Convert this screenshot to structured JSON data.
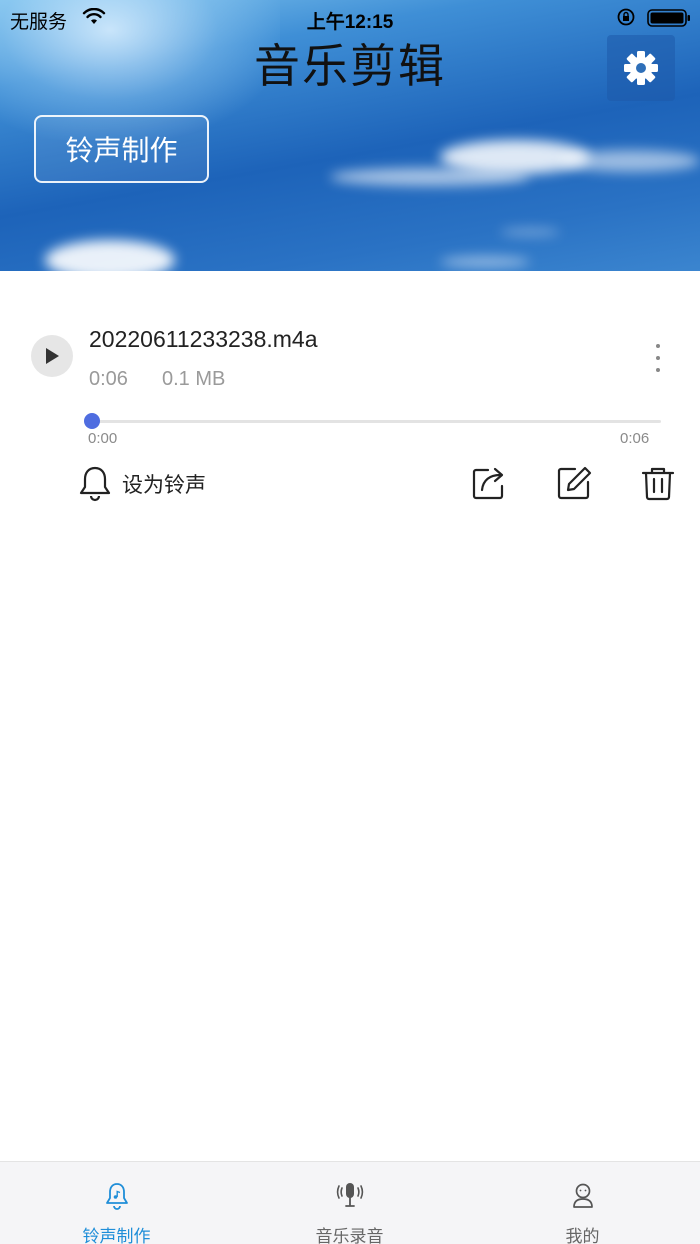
{
  "status_bar": {
    "carrier": "无服务",
    "time": "上午12:15"
  },
  "header": {
    "title": "音乐剪辑",
    "settings_icon": "gear-icon",
    "primary_button": "铃声制作"
  },
  "recording": {
    "file_name": "20220611233238.m4a",
    "duration": "0:06",
    "size": "0.1 MB",
    "progress": 0,
    "time_start": "0:00",
    "time_end": "0:06",
    "set_ringtone_label": "设为铃声",
    "actions": [
      "share-icon",
      "edit-icon",
      "delete-icon"
    ]
  },
  "tabs": [
    {
      "label": "铃声制作",
      "icon": "bell-music-icon",
      "active": true
    },
    {
      "label": "音乐录音",
      "icon": "microphone-icon",
      "active": false
    },
    {
      "label": "我的",
      "icon": "user-icon",
      "active": false
    }
  ],
  "colors": {
    "accent": "#4f6de0",
    "tab_active": "#1f8ed8"
  }
}
